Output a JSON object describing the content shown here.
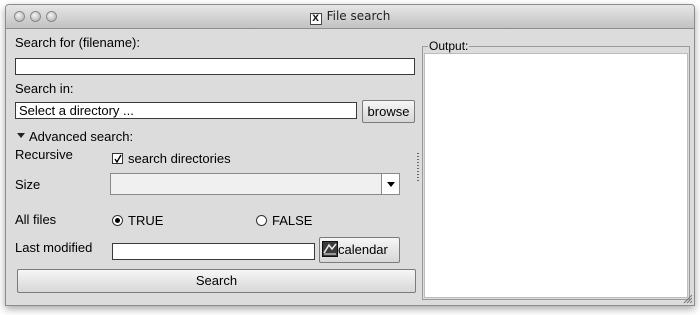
{
  "window": {
    "title": "File search"
  },
  "search": {
    "label": "Search for (filename):",
    "value": ""
  },
  "search_in": {
    "label": "Search in:",
    "value": "Select a directory ...",
    "browse_label": "browse"
  },
  "advanced": {
    "label": "Advanced search:",
    "expanded": true,
    "recursive_label": "Recursive",
    "recursive_checkbox_label": "search directories",
    "recursive_checked": true,
    "size_label": "Size",
    "size_value": "",
    "all_files_label": "All files",
    "options": {
      "true_label": "TRUE",
      "false_label": "FALSE",
      "selected": "TRUE"
    },
    "last_modified_label": "Last modified",
    "last_modified_value": "",
    "calendar_label": "calendar"
  },
  "search_button_label": "Search",
  "output": {
    "label": "Output:",
    "content": ""
  },
  "icons": {
    "close": "traffic-light-close-icon",
    "minimize": "traffic-light-minimize-icon",
    "zoom": "traffic-light-zoom-icon",
    "app": "x11-icon",
    "calendar": "calendar-icon",
    "expander": "triangle-down-icon",
    "combo": "chevron-down-icon"
  }
}
